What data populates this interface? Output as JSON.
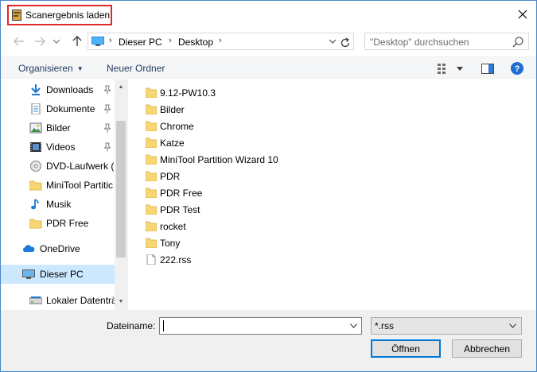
{
  "window": {
    "title": "Scanergebnis laden"
  },
  "address": {
    "crumbs": [
      "Dieser PC",
      "Desktop"
    ],
    "search_placeholder": "\"Desktop\" durchsuchen"
  },
  "toolbar": {
    "organize_label": "Organisieren",
    "new_folder_label": "Neuer Ordner"
  },
  "nav": {
    "items": [
      {
        "label": "Downloads",
        "icon": "download-icon",
        "pinned": true
      },
      {
        "label": "Dokumente",
        "icon": "documents-icon",
        "pinned": true
      },
      {
        "label": "Bilder",
        "icon": "pictures-icon",
        "pinned": true
      },
      {
        "label": "Videos",
        "icon": "videos-icon",
        "pinned": true
      },
      {
        "label": "DVD-Laufwerk (E",
        "icon": "dvd-drive-icon",
        "pinned": false
      },
      {
        "label": "MiniTool Partitic",
        "icon": "folder-icon",
        "pinned": false
      },
      {
        "label": "Musik",
        "icon": "music-icon",
        "pinned": false
      },
      {
        "label": "PDR Free",
        "icon": "folder-icon",
        "pinned": false
      },
      {
        "label": "OneDrive",
        "icon": "onedrive-icon",
        "pinned": false
      },
      {
        "label": "Dieser PC",
        "icon": "this-pc-icon",
        "pinned": false,
        "selected": true
      },
      {
        "label": "Lokaler Datenträg",
        "icon": "local-disk-icon",
        "pinned": false
      }
    ]
  },
  "files": [
    {
      "name": "9.12-PW10.3",
      "type": "folder"
    },
    {
      "name": "Bilder",
      "type": "folder"
    },
    {
      "name": "Chrome",
      "type": "folder"
    },
    {
      "name": "Katze",
      "type": "folder"
    },
    {
      "name": "MiniTool Partition Wizard 10",
      "type": "folder"
    },
    {
      "name": "PDR",
      "type": "folder"
    },
    {
      "name": "PDR Free",
      "type": "folder"
    },
    {
      "name": "PDR Test",
      "type": "folder"
    },
    {
      "name": "rocket",
      "type": "folder"
    },
    {
      "name": "Tony",
      "type": "folder"
    },
    {
      "name": "222.rss",
      "type": "file"
    }
  ],
  "bottom": {
    "filename_label": "Dateiname:",
    "filename_value": "",
    "filter_value": "*.rss",
    "open_label": "Öffnen",
    "cancel_label": "Abbrechen"
  },
  "colors": {
    "title_highlight": "#e0262b",
    "folder": "#f7d774",
    "selection": "#cce8ff",
    "accent": "#0078d7"
  }
}
